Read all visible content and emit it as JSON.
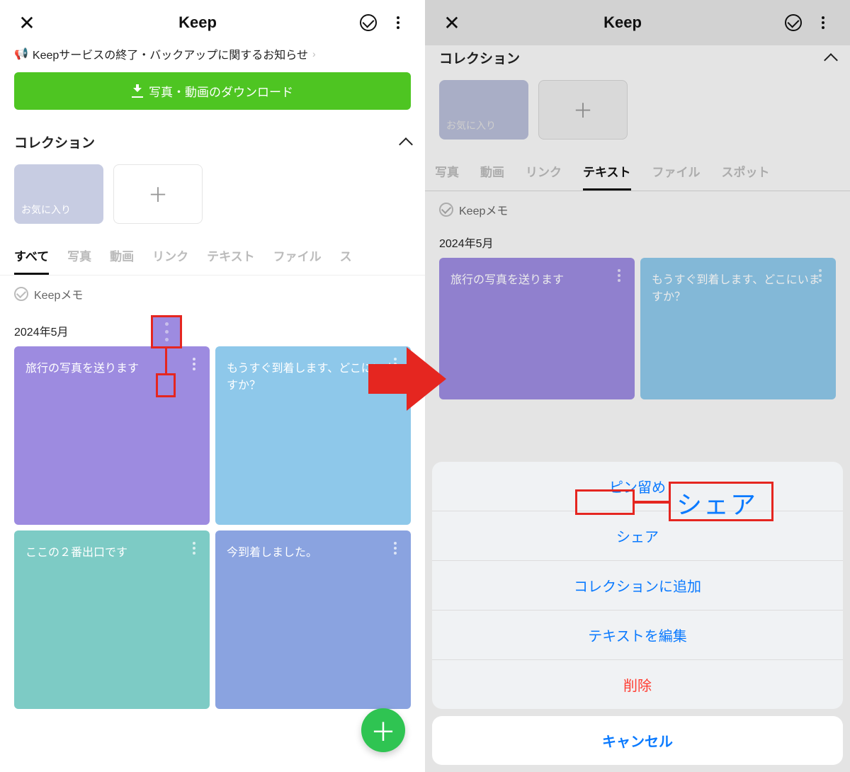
{
  "left": {
    "title": "Keep",
    "notice": "Keepサービスの終了・バックアップに関するお知らせ",
    "download_btn": "写真・動画のダウンロード",
    "collection_label": "コレクション",
    "fav_label": "お気に入り",
    "tabs": [
      "すべて",
      "写真",
      "動画",
      "リンク",
      "テキスト",
      "ファイル",
      "ス"
    ],
    "active_tab": 0,
    "memo_label": "Keepメモ",
    "date": "2024年5月",
    "cards": [
      {
        "text": "旅行の写真を送ります",
        "color": "purple"
      },
      {
        "text": "もうすぐ到着します、どこにいますか？",
        "color": "lightblue"
      },
      {
        "text": "ここの２番出口です",
        "color": "teal"
      },
      {
        "text": "今到着しました。",
        "color": "blue2"
      }
    ]
  },
  "right": {
    "title": "Keep",
    "collection_label": "コレクション",
    "fav_label": "お気に入り",
    "tabs": [
      "写真",
      "動画",
      "リンク",
      "テキスト",
      "ファイル",
      "スポット"
    ],
    "active_tab": 3,
    "memo_label": "Keepメモ",
    "date": "2024年5月",
    "cards": [
      {
        "text": "旅行の写真を送ります",
        "color": "purple"
      },
      {
        "text": "もうすぐ到着します、どこにいますか？",
        "color": "lightblue"
      }
    ],
    "sheet": {
      "pin": "ピン留め",
      "share": "シェア",
      "add_collection": "コレクションに追加",
      "edit_text": "テキストを編集",
      "delete": "削除",
      "cancel": "キャンセル"
    },
    "share_callout": "シェア"
  }
}
